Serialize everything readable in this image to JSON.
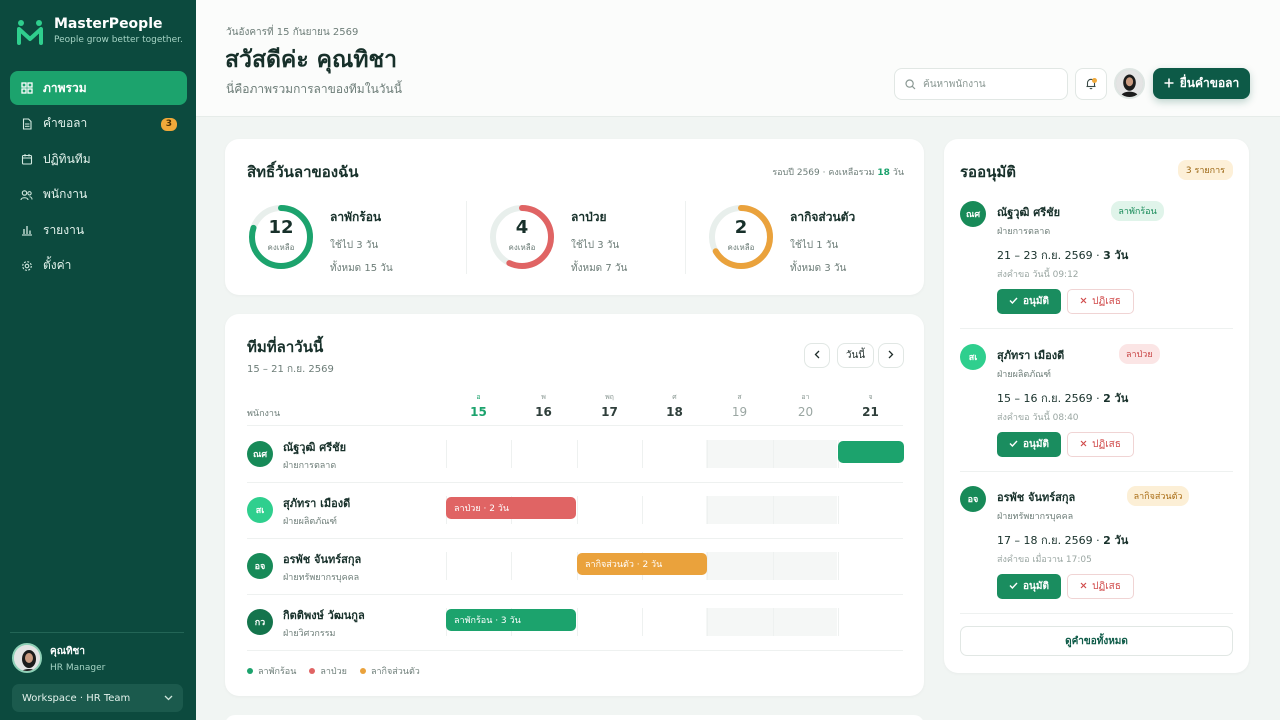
{
  "brand": {
    "name": "MasterPeople",
    "tagline": "People grow better together."
  },
  "sidebar": {
    "items": [
      {
        "label": "ภาพรวม",
        "icon": "grid-icon",
        "active": true
      },
      {
        "label": "คำขอลา",
        "icon": "document-icon",
        "badge": "3"
      },
      {
        "label": "ปฏิทินทีม",
        "icon": "calendar-icon"
      },
      {
        "label": "พนักงาน",
        "icon": "users-icon"
      },
      {
        "label": "รายงาน",
        "icon": "bar-chart-icon"
      },
      {
        "label": "ตั้งค่า",
        "icon": "gear-icon"
      }
    ],
    "user": {
      "name": "คุณทิชา",
      "role": "HR Manager"
    },
    "workspace": "Workspace · HR Team"
  },
  "header": {
    "date": "วันอังคารที่ 15 กันยายน 2569",
    "title": "สวัสดีค่ะ คุณทิชา",
    "subtitle": "นี่คือภาพรวมการลาของทีมในวันนี้",
    "search_placeholder": "ค้นหาพนักงาน",
    "cta_label": "ยื่นคำขอลา"
  },
  "entitlement": {
    "title": "สิทธิ์วันลาของฉัน",
    "meta_prefix": "รอบปี 2569 · คงเหลือรวม",
    "meta_total": "18",
    "meta_suffix": "วัน",
    "remaining_label": "คงเหลือ",
    "items": [
      {
        "type": "ลาพักร้อน",
        "remaining": "12",
        "used": "ใช้ไป 3 วัน",
        "total": "ทั้งหมด 15 วัน",
        "fraction": 0.8,
        "color": "#1ca36d"
      },
      {
        "type": "ลาป่วย",
        "remaining": "4",
        "used": "ใช้ไป 3 วัน",
        "total": "ทั้งหมด 7 วัน",
        "fraction": 0.571,
        "color": "#e06464"
      },
      {
        "type": "ลากิจส่วนตัว",
        "remaining": "2",
        "used": "ใช้ไป 1 วัน",
        "total": "ทั้งหมด 3 วัน",
        "fraction": 0.667,
        "color": "#eaa23c"
      }
    ]
  },
  "team": {
    "title": "ทีมที่ลาวันนี้",
    "range": "15 – 21 ก.ย. 2569",
    "today_button": "วันนี้",
    "employee_col": "พนักงาน",
    "days": [
      {
        "w": "อ",
        "n": "15",
        "today": true
      },
      {
        "w": "พ",
        "n": "16"
      },
      {
        "w": "พฤ",
        "n": "17"
      },
      {
        "w": "ศ",
        "n": "18"
      },
      {
        "w": "ส",
        "n": "19",
        "weekend": true
      },
      {
        "w": "อา",
        "n": "20",
        "weekend": true
      },
      {
        "w": "จ",
        "n": "21"
      }
    ],
    "rows": [
      {
        "initials": "ณศ",
        "name": "ณัฐวุฒิ ศรีชัย",
        "dept": "ฝ่ายการตลาด",
        "avatar_color": "#178a58",
        "bar": {
          "label": "",
          "start": 6,
          "span": 1,
          "color": "#1ca36d"
        }
      },
      {
        "initials": "สเ",
        "name": "สุภัทรา เมืองดี",
        "dept": "ฝ่ายผลิตภัณฑ์",
        "avatar_color": "#2fcf8e",
        "bar": {
          "label": "ลาป่วย · 2 วัน",
          "start": 0,
          "span": 2,
          "color": "#e06464"
        }
      },
      {
        "initials": "อจ",
        "name": "อรพัช จันทร์สกุล",
        "dept": "ฝ่ายทรัพยากรบุคคล",
        "avatar_color": "#178a58",
        "bar": {
          "label": "ลากิจส่วนตัว · 2 วัน",
          "start": 2,
          "span": 2,
          "color": "#eaa23c"
        }
      },
      {
        "initials": "กว",
        "name": "กิตติพงษ์ วัฒนกูล",
        "dept": "ฝ่ายวิศวกรรม",
        "avatar_color": "#14744c",
        "bar": {
          "label": "ลาพักร้อน · 3 วัน",
          "start": 0,
          "span": 2,
          "color": "#1ca36d"
        }
      }
    ],
    "legend": [
      {
        "label": "ลาพักร้อน",
        "color": "#1ca36d"
      },
      {
        "label": "ลาป่วย",
        "color": "#e06464"
      },
      {
        "label": "ลากิจส่วนตัว",
        "color": "#eaa23c"
      }
    ]
  },
  "pending": {
    "title": "รออนุมัติ",
    "count": "3 รายการ",
    "approve_label": "อนุมัติ",
    "reject_label": "ปฏิเสธ",
    "view_all": "ดูคำขอทั้งหมด",
    "requests": [
      {
        "initials": "ณศ",
        "name": "ณัฐวุฒิ ศรีชัย",
        "type": "ลาพักร้อน",
        "type_bg": "#e0f4ea",
        "type_fg": "#178a58",
        "dept": "ฝ่ายการตลาด",
        "dates": "21 – 23 ก.ย. 2569 · ",
        "days": "3 วัน",
        "sent": "ส่งคำขอ วันนี้ 09:12",
        "avatar_color": "#178a58"
      },
      {
        "initials": "สเ",
        "name": "สุภัทรา เมืองดี",
        "type": "ลาป่วย",
        "type_bg": "#fbe5e5",
        "type_fg": "#c84545",
        "dept": "ฝ่ายผลิตภัณฑ์",
        "dates": "15 – 16 ก.ย. 2569 · ",
        "days": "2 วัน",
        "sent": "ส่งคำขอ วันนี้ 08:40",
        "avatar_color": "#2fcf8e"
      },
      {
        "initials": "อจ",
        "name": "อรพัช จันทร์สกุล",
        "type": "ลากิจส่วนตัว",
        "type_bg": "#fcefd6",
        "type_fg": "#a86b12",
        "dept": "ฝ่ายทรัพยากรบุคคล",
        "dates": "17 – 18 ก.ย. 2569 · ",
        "days": "2 วัน",
        "sent": "ส่งคำขอ เมื่อวาน 17:05",
        "avatar_color": "#178a58"
      }
    ]
  }
}
